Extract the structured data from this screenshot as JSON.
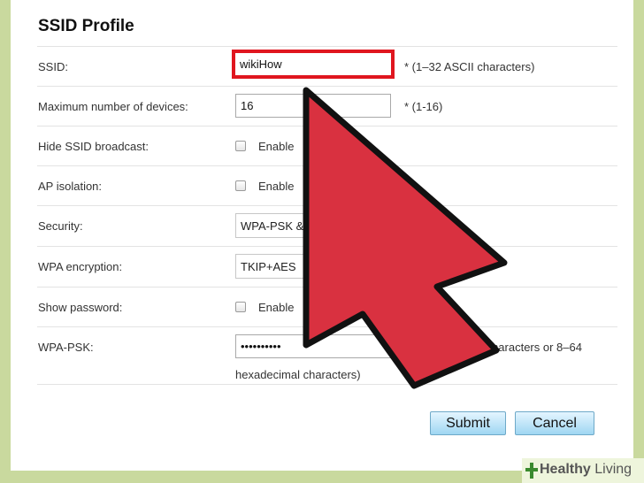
{
  "title": "SSID Profile",
  "rows": {
    "ssid": {
      "label": "SSID:",
      "value": "wikiHow",
      "hint": "*  (1–32 ASCII characters)"
    },
    "max_devices": {
      "label": "Maximum number of devices:",
      "value": "16",
      "hint": "*  (1-16)"
    },
    "hide_ssid": {
      "label": "Hide SSID broadcast:",
      "option": "Enable"
    },
    "ap_isolation": {
      "label": "AP isolation:",
      "option": "Enable"
    },
    "security": {
      "label": "Security:",
      "value": "WPA-PSK &"
    },
    "wpa_encryption": {
      "label": "WPA encryption:",
      "value": "TKIP+AES"
    },
    "show_password": {
      "label": "Show password:",
      "option": "Enable"
    },
    "wpa_psk": {
      "label": "WPA-PSK:",
      "value": "••••••••••",
      "hint": "ASCII characters or 8–64",
      "hint_line2": "hexadecimal characters)"
    }
  },
  "buttons": {
    "submit": "Submit",
    "cancel": "Cancel"
  },
  "brand": {
    "bold": "Healthy",
    "light": " Living"
  },
  "colors": {
    "arrow_fill": "#d93140",
    "highlight_border": "#e0161f",
    "button_gradient_top": "#e4f5ff",
    "button_gradient_bottom": "#9fd6f2",
    "background": "#c9d99e"
  },
  "icons": {
    "arrow": "pointer-arrow-icon",
    "brand": "plus-leaf-icon"
  }
}
